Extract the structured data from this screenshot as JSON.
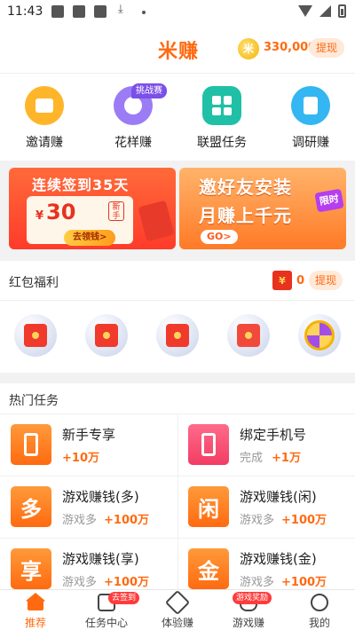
{
  "status_bar": {
    "time": "11:43"
  },
  "header": {
    "logo": "米赚",
    "coin_symbol": "米",
    "coins": "330,000",
    "withdraw": "提现"
  },
  "quick_entries": [
    {
      "label": "邀请赚",
      "icon": "invite-icon",
      "color": "#ffb52a"
    },
    {
      "label": "花样赚",
      "icon": "fancy-earn-icon",
      "color": "#9b7cf5",
      "badge": "挑战赛"
    },
    {
      "label": "联盟任务",
      "icon": "alliance-task-icon",
      "color": "#20c0a6"
    },
    {
      "label": "调研赚",
      "icon": "survey-icon",
      "color": "#33b6f2"
    }
  ],
  "banners": {
    "checkin": {
      "title": "连续签到35天",
      "currency": "¥",
      "amount": "30",
      "new_tag": "新手",
      "button": "去领钱>"
    },
    "invite": {
      "line1": "邀好友安装",
      "line2": "月赚上千元",
      "limited": "限时",
      "button": "GO>"
    }
  },
  "red_packet": {
    "title": "红包福利",
    "envelope_icon": "¥",
    "count": "0",
    "withdraw": "提现"
  },
  "hot_tasks": {
    "title": "热门任务",
    "items": [
      {
        "name": "新手专享",
        "sub": "",
        "reward": "+10万",
        "icon": "phone-icon"
      },
      {
        "name": "绑定手机号",
        "sub": "完成",
        "reward": "+1万",
        "icon": "bind-phone-icon"
      },
      {
        "name": "游戏赚钱(多)",
        "sub": "游戏多",
        "reward": "+100万",
        "icon_text": "多"
      },
      {
        "name": "游戏赚钱(闲)",
        "sub": "游戏多",
        "reward": "+100万",
        "icon_text": "闲"
      },
      {
        "name": "游戏赚钱(享)",
        "sub": "游戏多",
        "reward": "+100万",
        "icon_text": "享"
      },
      {
        "name": "游戏赚钱(金)",
        "sub": "游戏多",
        "reward": "+100万",
        "icon_text": "金"
      }
    ]
  },
  "tabbar": [
    {
      "label": "推荐",
      "active": true
    },
    {
      "label": "任务中心",
      "badge": "去签到"
    },
    {
      "label": "体验赚"
    },
    {
      "label": "游戏赚",
      "badge": "游戏奖励"
    },
    {
      "label": "我的"
    }
  ],
  "colors": {
    "accent": "#ff6a10",
    "red": "#e8321e"
  }
}
